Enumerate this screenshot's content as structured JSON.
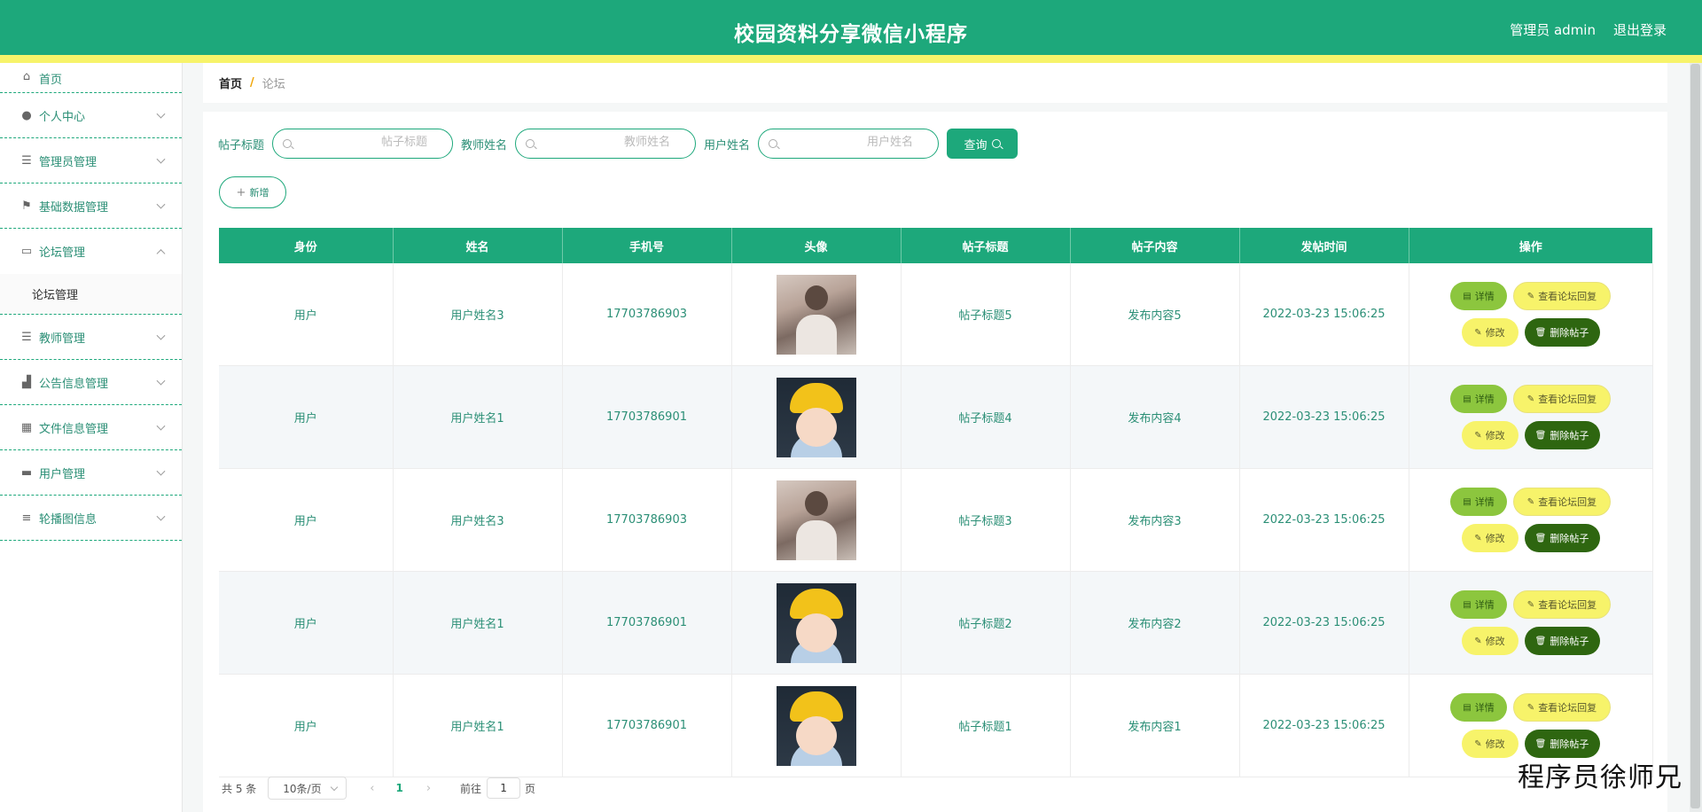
{
  "header": {
    "title": "校园资料分享微信小程序",
    "admin": "管理员 admin",
    "logout": "退出登录"
  },
  "sidebar": {
    "items": [
      {
        "icon": "home-icon",
        "label": "首页"
      },
      {
        "icon": "user-icon",
        "label": "个人中心"
      },
      {
        "icon": "list-icon",
        "label": "管理员管理"
      },
      {
        "icon": "flag-icon",
        "label": "基础数据管理"
      },
      {
        "icon": "forum-icon",
        "label": "论坛管理",
        "expanded": true,
        "subitems": [
          "论坛管理"
        ]
      },
      {
        "icon": "list-icon",
        "label": "教师管理"
      },
      {
        "icon": "notice-icon",
        "label": "公告信息管理"
      },
      {
        "icon": "grid-icon",
        "label": "文件信息管理"
      },
      {
        "icon": "monitor-icon",
        "label": "用户管理"
      },
      {
        "icon": "slider-icon",
        "label": "轮播图信息"
      }
    ]
  },
  "breadcrumb": {
    "home": "首页",
    "separator": "/",
    "current": "论坛"
  },
  "filters": {
    "title_label": "帖子标题",
    "title_placeholder": "帖子标题",
    "teacher_label": "教师姓名",
    "teacher_placeholder": "教师姓名",
    "user_label": "用户姓名",
    "user_placeholder": "用户姓名",
    "query": "查询"
  },
  "add_button": "新增",
  "table": {
    "columns": [
      "身份",
      "姓名",
      "手机号",
      "头像",
      "帖子标题",
      "帖子内容",
      "发帖时间",
      "操作"
    ],
    "rows": [
      {
        "role": "用户",
        "name": "用户姓名3",
        "phone": "17703786903",
        "avatar": "photo",
        "title": "帖子标题5",
        "content": "发布内容5",
        "time": "2022-03-23 15:06:25"
      },
      {
        "role": "用户",
        "name": "用户姓名1",
        "phone": "17703786901",
        "avatar": "cartoon",
        "title": "帖子标题4",
        "content": "发布内容4",
        "time": "2022-03-23 15:06:25"
      },
      {
        "role": "用户",
        "name": "用户姓名3",
        "phone": "17703786903",
        "avatar": "photo",
        "title": "帖子标题3",
        "content": "发布内容3",
        "time": "2022-03-23 15:06:25"
      },
      {
        "role": "用户",
        "name": "用户姓名1",
        "phone": "17703786901",
        "avatar": "cartoon",
        "title": "帖子标题2",
        "content": "发布内容2",
        "time": "2022-03-23 15:06:25"
      },
      {
        "role": "用户",
        "name": "用户姓名1",
        "phone": "17703786901",
        "avatar": "cartoon",
        "title": "帖子标题1",
        "content": "发布内容1",
        "time": "2022-03-23 15:06:25"
      }
    ],
    "actions": {
      "detail": "详情",
      "reply": "查看论坛回复",
      "edit": "修改",
      "delete": "删除帖子"
    }
  },
  "pagination": {
    "total": "共 5 条",
    "page_size": "10条/页",
    "prev": "‹",
    "current": "1",
    "next": "›",
    "goto": "前往",
    "goto_value": "1",
    "page_suffix": "页"
  },
  "watermark": "程序员徐师兄",
  "colors": {
    "primary": "#1da87b",
    "accent_yellow": "#f7f36a",
    "detail_green": "#8cc63e",
    "delete_green": "#2e6610"
  }
}
